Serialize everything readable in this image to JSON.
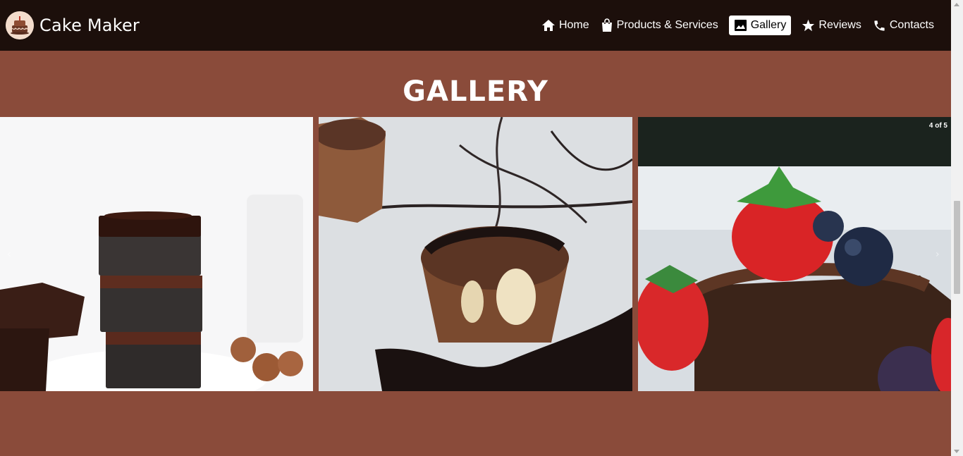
{
  "brand": {
    "name": "Cake Maker",
    "logo_icon": "cake-icon"
  },
  "nav": {
    "items": [
      {
        "label": "Home",
        "icon": "home-icon"
      },
      {
        "label": "Products & Services",
        "icon": "shopping-bag-icon"
      },
      {
        "label": "Gallery",
        "icon": "image-icon",
        "active": true
      },
      {
        "label": "Reviews",
        "icon": "star-icon"
      },
      {
        "label": "Contacts",
        "icon": "phone-icon"
      }
    ]
  },
  "page": {
    "title": "GALLERY"
  },
  "carousel": {
    "counter": "4 of 5",
    "slides": [
      {
        "icon": "brownie-stack-photo"
      },
      {
        "icon": "chocolate-cup-photo"
      },
      {
        "icon": "strawberry-brownie-photo"
      }
    ],
    "dots_total": 3,
    "active_dot": 3
  },
  "colors": {
    "navbar": "#1c0f0b",
    "background": "#8a4b3a",
    "accent": "#ffffff"
  }
}
